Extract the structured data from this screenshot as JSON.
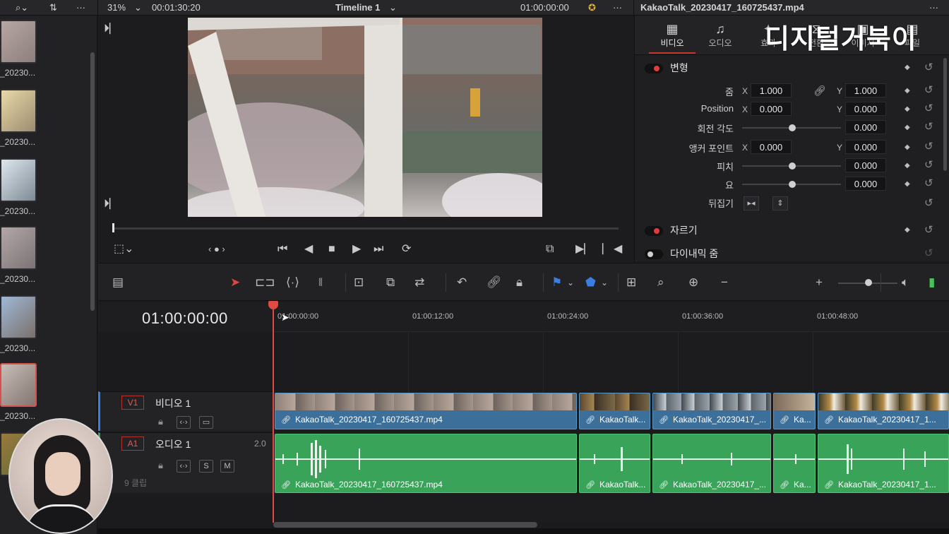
{
  "topbar": {
    "zoom": "31%",
    "source_timecode": "00:01:30:20",
    "timeline_name": "Timeline 1",
    "record_timecode": "01:00:00:00",
    "clip_title": "KakaoTalk_20230417_160725437.mp4"
  },
  "media_pool": {
    "clip_label": "_20230..."
  },
  "inspector": {
    "tabs": [
      {
        "label": "비디오",
        "icon": "film-icon"
      },
      {
        "label": "오디오",
        "icon": "music-note-icon"
      },
      {
        "label": "효과",
        "icon": "effects-icon"
      },
      {
        "label": "전환",
        "icon": "transition-icon"
      },
      {
        "label": "이미지",
        "icon": "image-icon"
      },
      {
        "label": "파일",
        "icon": "file-icon"
      }
    ],
    "watermark": "디지털거북이",
    "transform_header": "변형",
    "zoom_label": "줌",
    "zoom_x": "1.000",
    "zoom_y": "1.000",
    "position_label": "Position",
    "position_x": "0.000",
    "position_y": "0.000",
    "rotation_label": "회전 각도",
    "rotation_value": "0.000",
    "anchor_label": "앵커 포인트",
    "anchor_x": "0.000",
    "anchor_y": "0.000",
    "pitch_label": "피치",
    "pitch_value": "0.000",
    "yaw_label": "요",
    "yaw_value": "0.000",
    "flip_label": "뒤집기",
    "crop_header": "자르기",
    "dynamic_zoom_header": "다이내믹 줌",
    "axis_x": "X",
    "axis_y": "Y"
  },
  "timeline": {
    "timecode": "01:00:00:00",
    "ruler": [
      "01:00:00:00",
      "01:00:12:00",
      "01:00:24:00",
      "01:00:36:00",
      "01:00:48:00"
    ],
    "video_track": {
      "id": "V1",
      "name": "비디오 1"
    },
    "audio_track": {
      "id": "A1",
      "name": "오디오 1",
      "level": "2.0",
      "clip_count": "9 클립",
      "solo": "S",
      "mute": "M"
    },
    "clips": [
      {
        "name": "KakaoTalk_20230417_160725437.mp4"
      },
      {
        "name": "KakaoTalk..."
      },
      {
        "name": "KakaoTalk_20230417_..."
      },
      {
        "name": "Ka..."
      },
      {
        "name": "KakaoTalk_20230417_1..."
      }
    ]
  },
  "colors": {
    "accent_red": "#e04a45",
    "video_clip": "#3c6f99",
    "audio_clip": "#3aa35a",
    "marker_blue": "#3a7ee0"
  }
}
